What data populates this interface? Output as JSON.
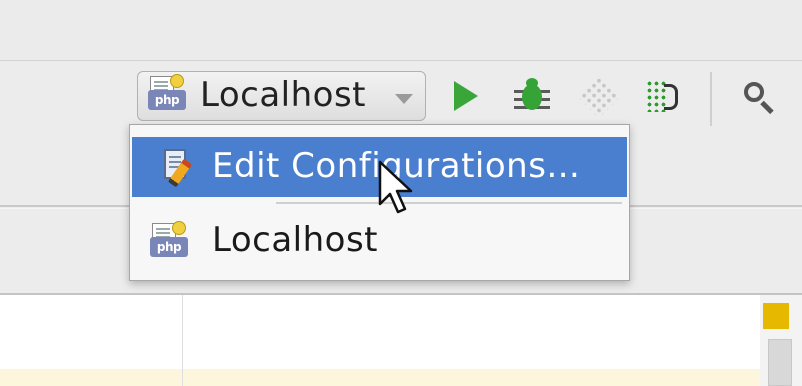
{
  "toolbar": {
    "run_config": {
      "selected_label": "Localhost",
      "icon": "php-server-icon"
    },
    "buttons": [
      {
        "name": "run-button",
        "icon": "play-icon",
        "color": "#3aa63a"
      },
      {
        "name": "debug-button",
        "icon": "bug-icon",
        "color": "#36a336"
      },
      {
        "name": "profile-button",
        "icon": "disabled-dots-icon",
        "enabled": false
      },
      {
        "name": "coverage-button",
        "icon": "run-with-coverage-icon"
      },
      {
        "name": "search-button",
        "icon": "magnifier-icon"
      }
    ]
  },
  "dropdown": {
    "items": [
      {
        "label": "Edit Configurations...",
        "icon": "edit-configurations-icon",
        "selected": true
      },
      {
        "label": "Localhost",
        "icon": "php-server-icon",
        "selected": false
      }
    ]
  },
  "editor": {
    "warning_marker_color": "#e7b800"
  },
  "theme": {
    "selection_color": "#4a7fd0",
    "toolbar_bg": "#ececec"
  },
  "icons": {
    "php_badge_text": "php"
  }
}
